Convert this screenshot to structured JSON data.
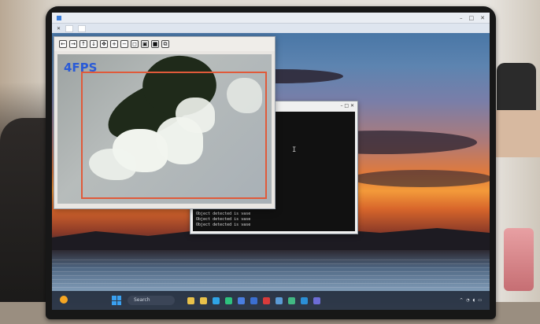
{
  "camera": {
    "fps_label": "4FPS",
    "toolbar_icons": [
      "arrow-left-icon",
      "arrow-right-icon",
      "arrow-up-icon",
      "arrow-down-icon",
      "pan-icon",
      "zoom-in-icon",
      "zoom-out-icon",
      "zoom-fit-icon",
      "save-icon",
      "settings-icon",
      "copy-icon"
    ]
  },
  "terminal": {
    "lines": [
      "Object detected is  vase",
      "Object detected is  vase",
      "Object detected is  vase"
    ]
  },
  "taskbar": {
    "search_label": "Search"
  },
  "colors": {
    "fps": "#2a5bd7",
    "detection_box": "#e05a3a"
  }
}
